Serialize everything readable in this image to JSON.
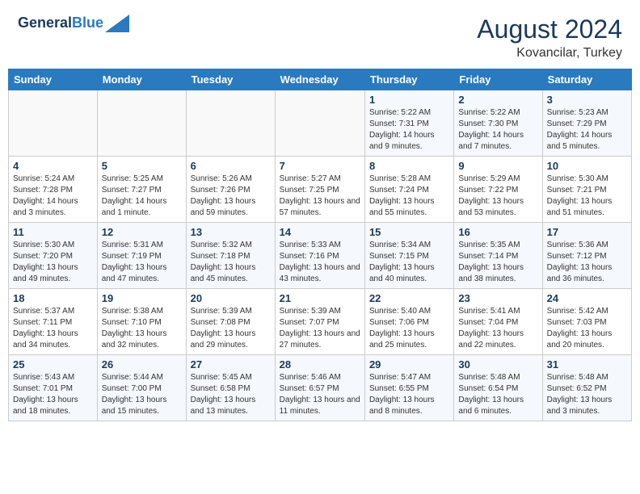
{
  "header": {
    "logo_line1": "General",
    "logo_line2": "Blue",
    "month_year": "August 2024",
    "location": "Kovancilar, Turkey"
  },
  "days_of_week": [
    "Sunday",
    "Monday",
    "Tuesday",
    "Wednesday",
    "Thursday",
    "Friday",
    "Saturday"
  ],
  "weeks": [
    [
      {
        "day": "",
        "sunrise": "",
        "sunset": "",
        "daylight": ""
      },
      {
        "day": "",
        "sunrise": "",
        "sunset": "",
        "daylight": ""
      },
      {
        "day": "",
        "sunrise": "",
        "sunset": "",
        "daylight": ""
      },
      {
        "day": "",
        "sunrise": "",
        "sunset": "",
        "daylight": ""
      },
      {
        "day": "1",
        "sunrise": "Sunrise: 5:22 AM",
        "sunset": "Sunset: 7:31 PM",
        "daylight": "Daylight: 14 hours and 9 minutes."
      },
      {
        "day": "2",
        "sunrise": "Sunrise: 5:22 AM",
        "sunset": "Sunset: 7:30 PM",
        "daylight": "Daylight: 14 hours and 7 minutes."
      },
      {
        "day": "3",
        "sunrise": "Sunrise: 5:23 AM",
        "sunset": "Sunset: 7:29 PM",
        "daylight": "Daylight: 14 hours and 5 minutes."
      }
    ],
    [
      {
        "day": "4",
        "sunrise": "Sunrise: 5:24 AM",
        "sunset": "Sunset: 7:28 PM",
        "daylight": "Daylight: 14 hours and 3 minutes."
      },
      {
        "day": "5",
        "sunrise": "Sunrise: 5:25 AM",
        "sunset": "Sunset: 7:27 PM",
        "daylight": "Daylight: 14 hours and 1 minute."
      },
      {
        "day": "6",
        "sunrise": "Sunrise: 5:26 AM",
        "sunset": "Sunset: 7:26 PM",
        "daylight": "Daylight: 13 hours and 59 minutes."
      },
      {
        "day": "7",
        "sunrise": "Sunrise: 5:27 AM",
        "sunset": "Sunset: 7:25 PM",
        "daylight": "Daylight: 13 hours and 57 minutes."
      },
      {
        "day": "8",
        "sunrise": "Sunrise: 5:28 AM",
        "sunset": "Sunset: 7:24 PM",
        "daylight": "Daylight: 13 hours and 55 minutes."
      },
      {
        "day": "9",
        "sunrise": "Sunrise: 5:29 AM",
        "sunset": "Sunset: 7:22 PM",
        "daylight": "Daylight: 13 hours and 53 minutes."
      },
      {
        "day": "10",
        "sunrise": "Sunrise: 5:30 AM",
        "sunset": "Sunset: 7:21 PM",
        "daylight": "Daylight: 13 hours and 51 minutes."
      }
    ],
    [
      {
        "day": "11",
        "sunrise": "Sunrise: 5:30 AM",
        "sunset": "Sunset: 7:20 PM",
        "daylight": "Daylight: 13 hours and 49 minutes."
      },
      {
        "day": "12",
        "sunrise": "Sunrise: 5:31 AM",
        "sunset": "Sunset: 7:19 PM",
        "daylight": "Daylight: 13 hours and 47 minutes."
      },
      {
        "day": "13",
        "sunrise": "Sunrise: 5:32 AM",
        "sunset": "Sunset: 7:18 PM",
        "daylight": "Daylight: 13 hours and 45 minutes."
      },
      {
        "day": "14",
        "sunrise": "Sunrise: 5:33 AM",
        "sunset": "Sunset: 7:16 PM",
        "daylight": "Daylight: 13 hours and 43 minutes."
      },
      {
        "day": "15",
        "sunrise": "Sunrise: 5:34 AM",
        "sunset": "Sunset: 7:15 PM",
        "daylight": "Daylight: 13 hours and 40 minutes."
      },
      {
        "day": "16",
        "sunrise": "Sunrise: 5:35 AM",
        "sunset": "Sunset: 7:14 PM",
        "daylight": "Daylight: 13 hours and 38 minutes."
      },
      {
        "day": "17",
        "sunrise": "Sunrise: 5:36 AM",
        "sunset": "Sunset: 7:12 PM",
        "daylight": "Daylight: 13 hours and 36 minutes."
      }
    ],
    [
      {
        "day": "18",
        "sunrise": "Sunrise: 5:37 AM",
        "sunset": "Sunset: 7:11 PM",
        "daylight": "Daylight: 13 hours and 34 minutes."
      },
      {
        "day": "19",
        "sunrise": "Sunrise: 5:38 AM",
        "sunset": "Sunset: 7:10 PM",
        "daylight": "Daylight: 13 hours and 32 minutes."
      },
      {
        "day": "20",
        "sunrise": "Sunrise: 5:39 AM",
        "sunset": "Sunset: 7:08 PM",
        "daylight": "Daylight: 13 hours and 29 minutes."
      },
      {
        "day": "21",
        "sunrise": "Sunrise: 5:39 AM",
        "sunset": "Sunset: 7:07 PM",
        "daylight": "Daylight: 13 hours and 27 minutes."
      },
      {
        "day": "22",
        "sunrise": "Sunrise: 5:40 AM",
        "sunset": "Sunset: 7:06 PM",
        "daylight": "Daylight: 13 hours and 25 minutes."
      },
      {
        "day": "23",
        "sunrise": "Sunrise: 5:41 AM",
        "sunset": "Sunset: 7:04 PM",
        "daylight": "Daylight: 13 hours and 22 minutes."
      },
      {
        "day": "24",
        "sunrise": "Sunrise: 5:42 AM",
        "sunset": "Sunset: 7:03 PM",
        "daylight": "Daylight: 13 hours and 20 minutes."
      }
    ],
    [
      {
        "day": "25",
        "sunrise": "Sunrise: 5:43 AM",
        "sunset": "Sunset: 7:01 PM",
        "daylight": "Daylight: 13 hours and 18 minutes."
      },
      {
        "day": "26",
        "sunrise": "Sunrise: 5:44 AM",
        "sunset": "Sunset: 7:00 PM",
        "daylight": "Daylight: 13 hours and 15 minutes."
      },
      {
        "day": "27",
        "sunrise": "Sunrise: 5:45 AM",
        "sunset": "Sunset: 6:58 PM",
        "daylight": "Daylight: 13 hours and 13 minutes."
      },
      {
        "day": "28",
        "sunrise": "Sunrise: 5:46 AM",
        "sunset": "Sunset: 6:57 PM",
        "daylight": "Daylight: 13 hours and 11 minutes."
      },
      {
        "day": "29",
        "sunrise": "Sunrise: 5:47 AM",
        "sunset": "Sunset: 6:55 PM",
        "daylight": "Daylight: 13 hours and 8 minutes."
      },
      {
        "day": "30",
        "sunrise": "Sunrise: 5:48 AM",
        "sunset": "Sunset: 6:54 PM",
        "daylight": "Daylight: 13 hours and 6 minutes."
      },
      {
        "day": "31",
        "sunrise": "Sunrise: 5:48 AM",
        "sunset": "Sunset: 6:52 PM",
        "daylight": "Daylight: 13 hours and 3 minutes."
      }
    ]
  ]
}
